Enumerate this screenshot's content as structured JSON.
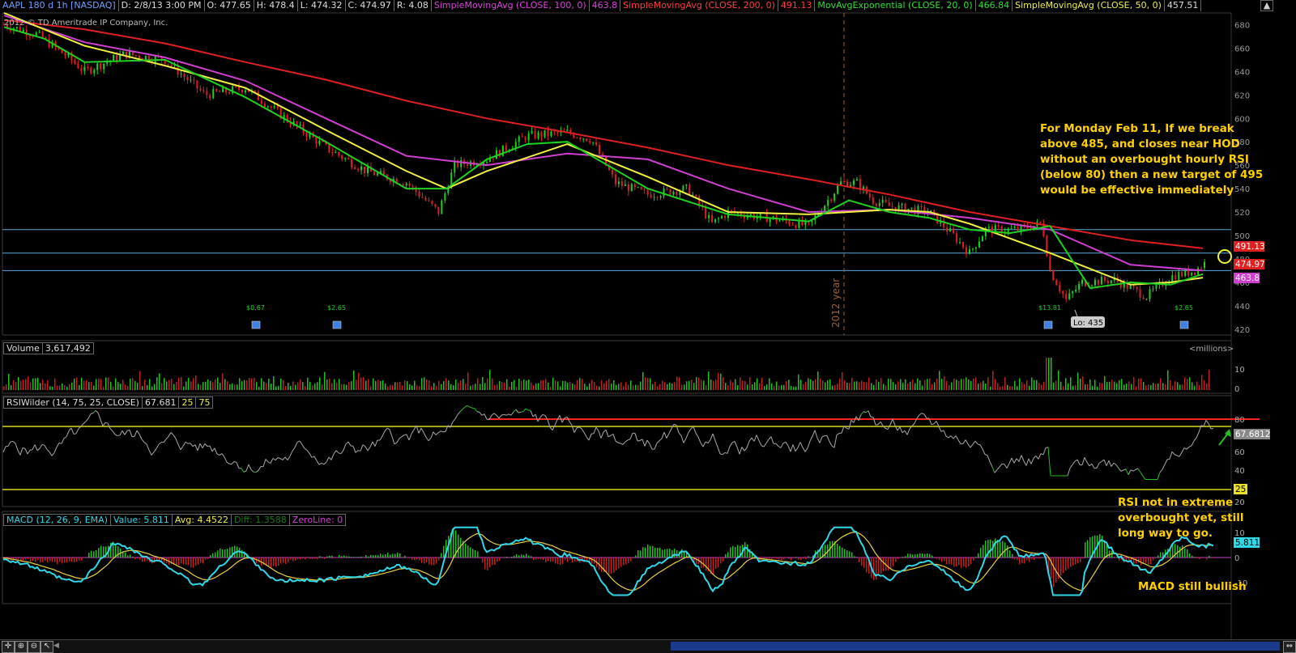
{
  "header": {
    "symbol": "AAPL 180 d 1h [NASDAQ]",
    "date": "D: 2/8/13 3:00 PM",
    "open": "O: 477.65",
    "high": "H: 478.4",
    "low": "L: 474.32",
    "close": "C: 474.97",
    "range": "R: 4.08",
    "sma100_label": "SimpleMovingAvg (CLOSE, 100, 0)",
    "sma100_value": "463.8",
    "sma200_label": "SimpleMovingAvg (CLOSE, 200, 0)",
    "sma200_value": "491.13",
    "ema20_label": "MovAvgExponential (CLOSE, 20, 0)",
    "ema20_value": "466.84",
    "sma50_label": "SimpleMovingAvg (CLOSE, 50, 0)",
    "sma50_value": "457.51"
  },
  "copyright": "2012 © TD Ameritrade IP Company, Inc.",
  "year_marker": "2012 year",
  "low_marker": "Lo: 435",
  "events": [
    {
      "text": "$0.67",
      "x": 316
    },
    {
      "text": "$2.65",
      "x": 416
    },
    {
      "text": "$13.81",
      "x": 1294
    },
    {
      "text": "$2.65",
      "x": 1462
    }
  ],
  "price_badges": {
    "sma200": "491.13",
    "close": "474.97",
    "sma100": "463.8"
  },
  "volume_panel": {
    "label": "Volume",
    "value": "3,617,492",
    "unit": "<millions>",
    "ticks": [
      "10",
      "0"
    ]
  },
  "rsi_panel": {
    "label": "RSIWilder (14, 75, 25, CLOSE)",
    "value": "67.681",
    "ob": "25",
    "os": "75",
    "badge": "67.6812",
    "level_badge": "25",
    "ticks": [
      "80",
      "60",
      "40",
      "20"
    ]
  },
  "macd_panel": {
    "label": "MACD (12, 26, 9, EMA)",
    "value": "Value: 5.811",
    "avg": "Avg: 4.4522",
    "diff": "Diff: 1.3588",
    "zeroline": "ZeroLine: 0",
    "badge": "5.811",
    "ticks": [
      "10",
      "0",
      "-10"
    ]
  },
  "annotations": {
    "main": "For Monday Feb 11, If we break above 485, and closes near HOD without an overbought hourly RSI (below 80) then a new target of 495 would be effective immediately",
    "main_lines": [
      "For Monday Feb 11, If we break",
      "above 485, and closes near HOD",
      "without an overbought hourly RSI",
      "(below 80) then a new target of 495",
      "would be effective immediately"
    ],
    "rsi_lines": [
      "RSI not in extreme",
      "overbought yet, still",
      "long way to go."
    ],
    "macd": "MACD still bullish"
  },
  "colors": {
    "sma200": "#e02020",
    "sma100": "#d040d0",
    "ema20": "#20d020",
    "sma50": "#f0f040",
    "macd": "#30d8e8",
    "signal": "#e8d040",
    "annotation": "#ffd000",
    "hline": "#5aa8d8"
  },
  "chart_data": {
    "type": "line",
    "title": "AAPL 180 d 1h [NASDAQ]",
    "xlabel": "",
    "ylabel": "",
    "ylim": [
      415,
      690
    ],
    "y_ticks": [
      680,
      660,
      640,
      620,
      600,
      580,
      560,
      540,
      520,
      500,
      480,
      460,
      440,
      420
    ],
    "horizontal_levels": [
      505,
      485,
      470
    ],
    "x_index_range": [
      0,
      1500
    ],
    "series": [
      {
        "name": "SimpleMovingAvg (CLOSE, 200, 0)",
        "points": [
          [
            0,
            684
          ],
          [
            100,
            676
          ],
          [
            200,
            664
          ],
          [
            300,
            648
          ],
          [
            400,
            633
          ],
          [
            500,
            615
          ],
          [
            600,
            600
          ],
          [
            700,
            588
          ],
          [
            800,
            575
          ],
          [
            900,
            560
          ],
          [
            1000,
            548
          ],
          [
            1100,
            535
          ],
          [
            1200,
            520
          ],
          [
            1300,
            508
          ],
          [
            1400,
            496
          ],
          [
            1490,
            489
          ]
        ]
      },
      {
        "name": "SimpleMovingAvg (CLOSE, 100, 0)",
        "points": [
          [
            0,
            688
          ],
          [
            100,
            665
          ],
          [
            200,
            652
          ],
          [
            300,
            632
          ],
          [
            400,
            600
          ],
          [
            500,
            568
          ],
          [
            600,
            560
          ],
          [
            700,
            570
          ],
          [
            800,
            565
          ],
          [
            900,
            540
          ],
          [
            1000,
            520
          ],
          [
            1100,
            522
          ],
          [
            1200,
            515
          ],
          [
            1300,
            505
          ],
          [
            1400,
            475
          ],
          [
            1490,
            470
          ]
        ]
      },
      {
        "name": "SimpleMovingAvg (CLOSE, 50, 0)",
        "points": [
          [
            0,
            690
          ],
          [
            100,
            662
          ],
          [
            200,
            645
          ],
          [
            300,
            626
          ],
          [
            400,
            590
          ],
          [
            500,
            555
          ],
          [
            550,
            540
          ],
          [
            600,
            555
          ],
          [
            700,
            578
          ],
          [
            800,
            550
          ],
          [
            900,
            520
          ],
          [
            1000,
            518
          ],
          [
            1050,
            520
          ],
          [
            1100,
            522
          ],
          [
            1150,
            520
          ],
          [
            1200,
            510
          ],
          [
            1300,
            485
          ],
          [
            1400,
            458
          ],
          [
            1450,
            460
          ],
          [
            1490,
            464
          ]
        ]
      },
      {
        "name": "MovAvgExponential (CLOSE, 20, 0)",
        "points": [
          [
            0,
            678
          ],
          [
            50,
            668
          ],
          [
            100,
            648
          ],
          [
            200,
            650
          ],
          [
            300,
            618
          ],
          [
            400,
            580
          ],
          [
            500,
            540
          ],
          [
            550,
            540
          ],
          [
            600,
            565
          ],
          [
            650,
            578
          ],
          [
            700,
            580
          ],
          [
            750,
            560
          ],
          [
            800,
            540
          ],
          [
            900,
            518
          ],
          [
            1000,
            512
          ],
          [
            1050,
            530
          ],
          [
            1100,
            520
          ],
          [
            1150,
            515
          ],
          [
            1200,
            505
          ],
          [
            1250,
            502
          ],
          [
            1300,
            508
          ],
          [
            1350,
            455
          ],
          [
            1400,
            460
          ],
          [
            1450,
            458
          ],
          [
            1490,
            467
          ]
        ]
      }
    ],
    "close_path": [
      [
        0,
        680
      ],
      [
        40,
        672
      ],
      [
        80,
        652
      ],
      [
        100,
        640
      ],
      [
        150,
        655
      ],
      [
        200,
        650
      ],
      [
        250,
        620
      ],
      [
        300,
        626
      ],
      [
        350,
        600
      ],
      [
        400,
        575
      ],
      [
        450,
        555
      ],
      [
        500,
        545
      ],
      [
        540,
        520
      ],
      [
        560,
        560
      ],
      [
        600,
        565
      ],
      [
        650,
        585
      ],
      [
        700,
        588
      ],
      [
        730,
        582
      ],
      [
        760,
        545
      ],
      [
        800,
        535
      ],
      [
        850,
        540
      ],
      [
        880,
        510
      ],
      [
        900,
        520
      ],
      [
        950,
        515
      ],
      [
        1000,
        508
      ],
      [
        1040,
        545
      ],
      [
        1060,
        545
      ],
      [
        1080,
        530
      ],
      [
        1100,
        525
      ],
      [
        1150,
        520
      ],
      [
        1180,
        500
      ],
      [
        1200,
        485
      ],
      [
        1220,
        505
      ],
      [
        1260,
        505
      ],
      [
        1290,
        510
      ],
      [
        1300,
        470
      ],
      [
        1320,
        445
      ],
      [
        1340,
        460
      ],
      [
        1380,
        462
      ],
      [
        1420,
        448
      ],
      [
        1450,
        465
      ],
      [
        1480,
        470
      ],
      [
        1495,
        478
      ]
    ],
    "volume_series": {
      "name": "Volume",
      "unit": "millions",
      "ylim": [
        0,
        15
      ]
    },
    "rsi_series": {
      "name": "RSIWilder (14, 75, 25, CLOSE)",
      "levels": [
        75,
        25
      ],
      "extreme_level": 80,
      "ylim": [
        0,
        90
      ]
    },
    "macd_series": {
      "name": "MACD (12, 26, 9, EMA)",
      "value": 5.811,
      "avg": 4.4522,
      "diff": 1.3588,
      "ylim": [
        -16,
        14
      ]
    }
  }
}
